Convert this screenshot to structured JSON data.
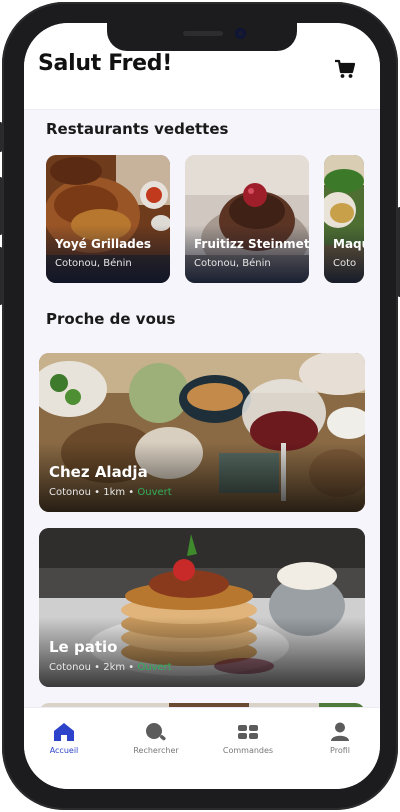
{
  "header": {
    "title": "Salut Fred!",
    "cart_icon": "cart-icon"
  },
  "featured": {
    "title": "Restaurants vedettes",
    "items": [
      {
        "name": "Yoyé Grillades",
        "location": "Cotonou, Bénin"
      },
      {
        "name": "Fruitizz Steinmetz",
        "location": "Cotonou, Bénin"
      },
      {
        "name": "Maqu",
        "location": "Coto"
      }
    ]
  },
  "nearby": {
    "title": "Proche de vous",
    "items": [
      {
        "name": "Chez Aladja",
        "city": "Cotonou",
        "distance": "1km",
        "status": "Ouvert"
      },
      {
        "name": "Le patio",
        "city": "Cotonou",
        "distance": "2km",
        "status": "Ouvert"
      }
    ]
  },
  "nav": {
    "items": [
      {
        "label": "Accueil",
        "icon": "home-icon",
        "active": true
      },
      {
        "label": "Rechercher",
        "icon": "search-icon",
        "active": false
      },
      {
        "label": "Commandes",
        "icon": "orders-icon",
        "active": false
      },
      {
        "label": "Profil",
        "icon": "profile-icon",
        "active": false
      }
    ]
  },
  "colors": {
    "accent": "#2d43c9",
    "open_status": "#2fb05a",
    "background": "#f6f5fb"
  }
}
